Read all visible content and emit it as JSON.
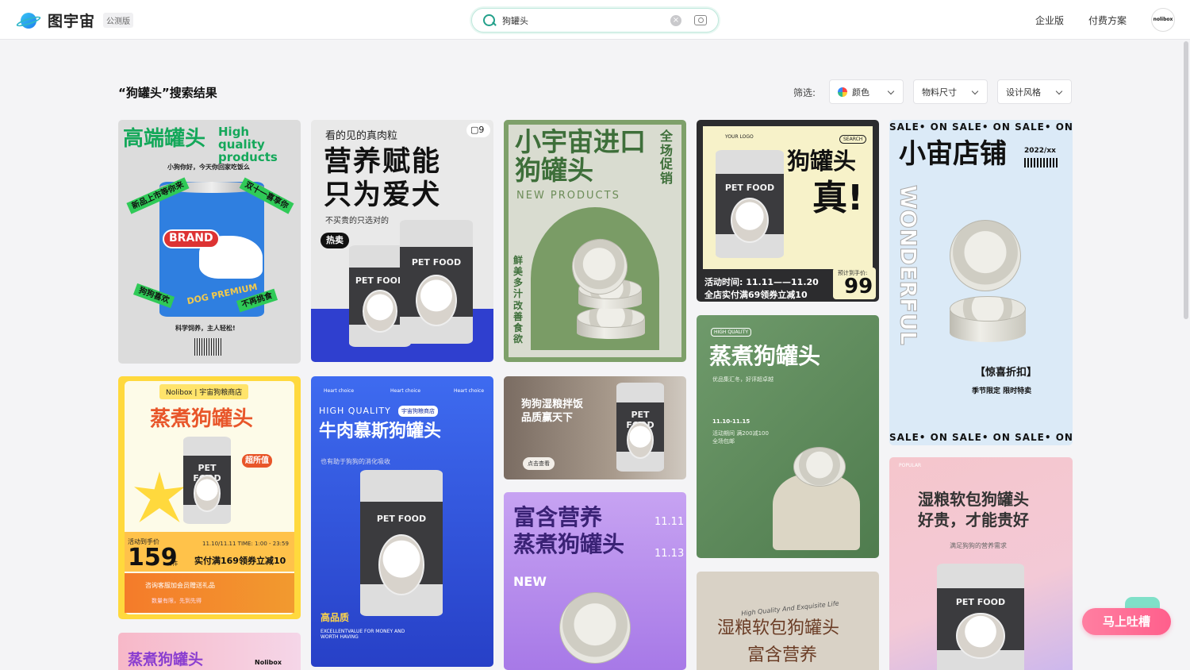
{
  "app": {
    "name": "图宇宙",
    "badge": "公测版"
  },
  "search": {
    "value": "狗罐头",
    "placeholder": ""
  },
  "nav": {
    "enterprise": "企业版",
    "pricing": "付费方案",
    "avatar": "nolibox"
  },
  "results": {
    "title": "“狗罐头”搜索结果"
  },
  "filters": {
    "label": "筛选:",
    "color": "颜色",
    "size": "物料尺寸",
    "style": "设计风格"
  },
  "cards": {
    "c1": {
      "title": "高端罐头",
      "en": "High quality products",
      "sub": "小狗你好，今天你回家吃饭么",
      "tag1": "新品上市等你来",
      "tag2": "双十一喜享你",
      "tag3": "狗狗喜欢",
      "tag4": "不再挑食",
      "bottom": "科学饲养，主人轻松!",
      "brand": "BRAND",
      "dog": "DOG PREMIUM"
    },
    "c2": {
      "title": "看的见的真肉粒",
      "big1": "营养赋能",
      "big2": "只为爱犬",
      "sub": "不买贵的只选对的",
      "hot": "热卖",
      "pages": "9",
      "can": "PET FOOD"
    },
    "c3": {
      "title1": "小宇宙进口",
      "title2": "狗罐头",
      "en": "NEW PRODUCTS",
      "side1": "全场促销",
      "side2": "鲜美多汁改善食欲"
    },
    "c4": {
      "logo": "YOUR LOGO",
      "title": "狗罐头",
      "title2": "真!",
      "search": "SEARCH",
      "line1": "活动时间: 11.11——11.20",
      "line2": "全店实付满69领券立减10",
      "pre": "预计到手价:",
      "price": "99"
    },
    "c5": {
      "marquee": "SALE• ON SALE• ON SALE• ON SA",
      "title": "小宙店铺",
      "date": "2022/xx",
      "side": "WONDERFUL",
      "tag": "【惊喜折扣】",
      "sub": "季节限定 限时特卖",
      "marquee2": "SALE• ON SALE• ON SALE• ON SA"
    },
    "c6": {
      "brand": "Nolibox | 宇宙狗粮商店",
      "title": "蒸煮狗罐头",
      "badge": "超所值",
      "pre": "活动到手价",
      "price": "159",
      "unit": "/件",
      "time": "11.10/11.11 TIME: 1:00 - 23:59",
      "deal": "实付满169领券立减10",
      "vip": "咨询客服加会员赠送礼品",
      "note": "数量有限，先到先得"
    },
    "c7": {
      "top": "Heart choice",
      "en": "HIGH QUALITY",
      "shop": "宇宙狗粮商店",
      "title": "牛肉慕斯狗罐头",
      "sub": "也有助于狗狗的消化吸收",
      "tag": "高品质",
      "foot": "EXCELLENTVALUE FOR MONEY AND WORTH HAVING"
    },
    "c8": {
      "title1": "狗狗湿粮拌饭",
      "title2": "品质赢天下",
      "btn": "点击查看"
    },
    "c9": {
      "title1": "富含营养",
      "title2": "蒸煮狗罐头",
      "d1": "11.11",
      "d2": "11.13",
      "tag": "NEW"
    },
    "c10": {
      "tag": "HIGH QUALITY",
      "title": "蒸煮狗罐头",
      "sub": "优品集汇冬，好评超卓越",
      "date": "11.10-11.15",
      "note": "活动期间 满200减100 全场包邮"
    },
    "c11": {
      "script": "High Quality And Exquisite Life",
      "title1": "湿粮软包狗罐头",
      "title2": "富含营养"
    },
    "c12": {
      "tag": "POPULAR",
      "title1": "湿粮软包狗罐头",
      "title2": "好贵，才能贵好",
      "sub": "满足狗狗的营养需求",
      "can": "PET FOOD"
    },
    "c13": {
      "title": "蒸煮狗罐头",
      "brand": "Nolibox"
    }
  },
  "feedback": "马上吐槽",
  "colors": {
    "accent": "#22a08a",
    "feedback": "#ff6a93"
  }
}
